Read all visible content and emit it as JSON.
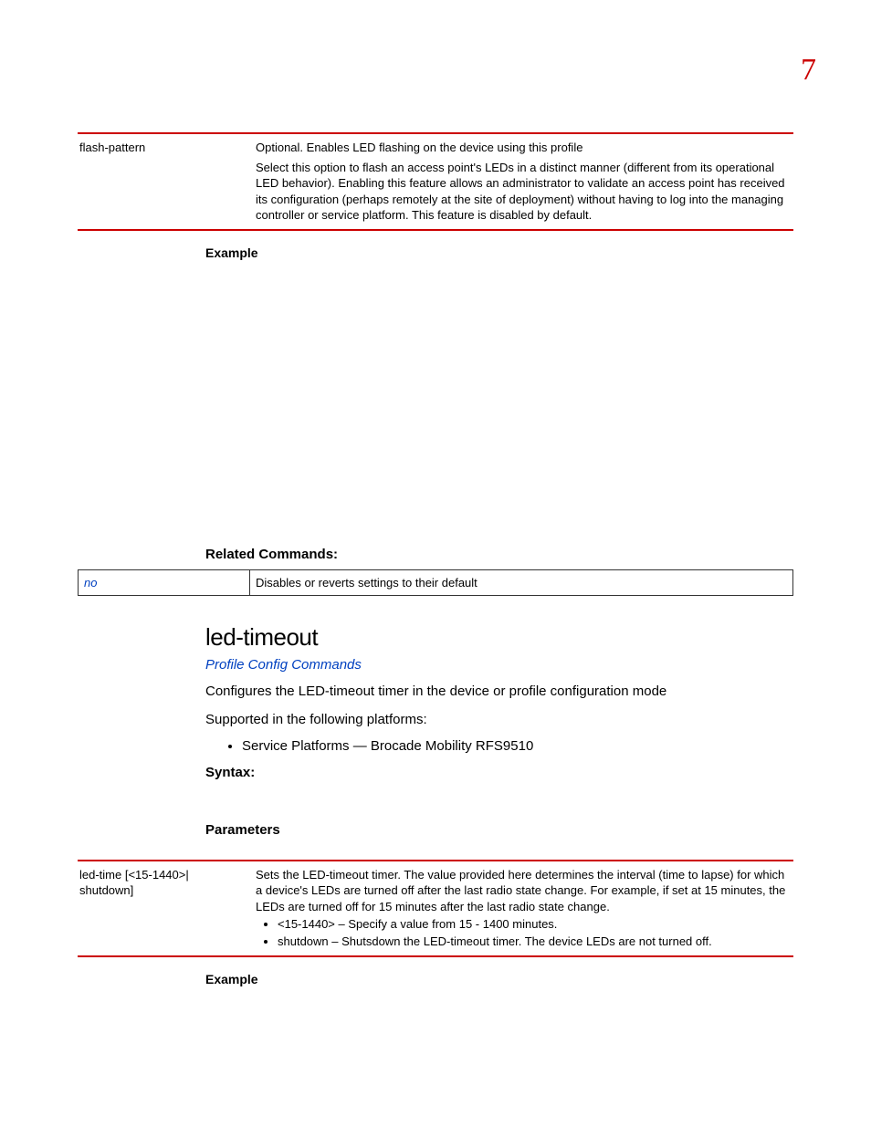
{
  "page_number": "7",
  "table1": {
    "param": "flash-pattern",
    "desc_line1": "Optional. Enables LED flashing on the device using this profile",
    "desc_line2": "Select this option to flash an access point's LEDs in a distinct manner (different from its operational LED behavior). Enabling this feature allows an administrator to validate an access point has received its configuration (perhaps remotely at the site of deployment) without having to log into the managing controller or service platform. This feature is disabled by default."
  },
  "example_label": "Example",
  "related_commands_label": "Related Commands:",
  "related_table": {
    "cmd": "no",
    "desc": "Disables or reverts settings to their default"
  },
  "section": {
    "title": "led-timeout",
    "link": "Profile Config Commands",
    "intro": "Configures the LED-timeout timer in the device or profile configuration mode",
    "supported": "Supported in the following platforms:",
    "platform": "Service Platforms — Brocade Mobility RFS9510",
    "syntax_label": "Syntax:",
    "params_label": "Parameters"
  },
  "table2": {
    "param": "led-time [<15-1440>|\nshutdown]",
    "desc": "Sets the LED-timeout timer. The value provided here determines the interval (time to lapse) for which a device's LEDs are turned off after the last radio state change. For example, if set at 15 minutes, the LEDs are turned off for 15 minutes after the last radio state change.",
    "b1": "<15-1440> – Specify a value from 15 - 1400 minutes.",
    "b2": "shutdown – Shutsdown the LED-timeout timer. The device LEDs are not turned off."
  },
  "example_label2": "Example"
}
